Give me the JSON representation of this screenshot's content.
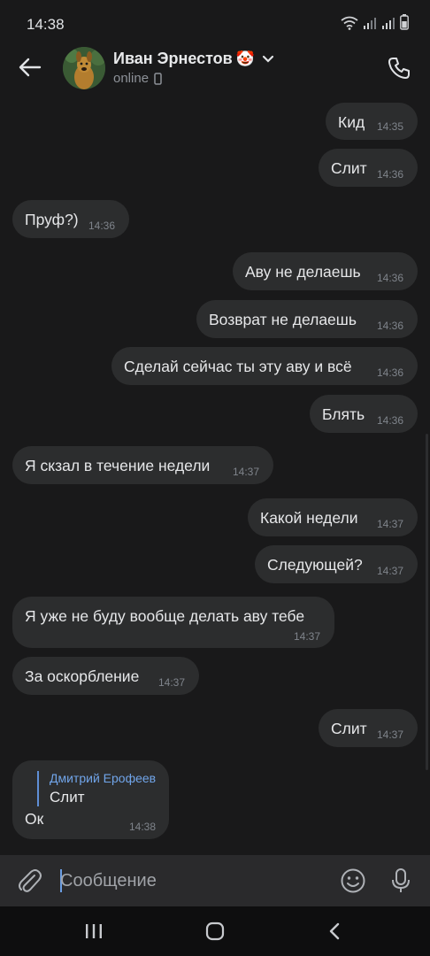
{
  "status_bar": {
    "time": "14:38"
  },
  "header": {
    "name": "Иван Эрнестов",
    "name_emoji": "🤡",
    "status": "online"
  },
  "messages": [
    {
      "dir": "out",
      "text": "Кид",
      "time": "14:35"
    },
    {
      "dir": "out",
      "text": "Слит",
      "time": "14:36"
    },
    {
      "dir": "in",
      "text": "Пруф?)",
      "time": "14:36"
    },
    {
      "dir": "out",
      "text": "Аву не делаешь",
      "time": "14:36"
    },
    {
      "dir": "out",
      "text": "Возврат не делаешь",
      "time": "14:36"
    },
    {
      "dir": "out",
      "text": "Сделай сейчас ты эту аву и всё",
      "time": "14:36"
    },
    {
      "dir": "out",
      "text": "Блять",
      "time": "14:36"
    },
    {
      "dir": "in",
      "text": "Я скзал в течение недели",
      "time": "14:37"
    },
    {
      "dir": "out",
      "text": "Какой недели",
      "time": "14:37"
    },
    {
      "dir": "out",
      "text": "Следующей?",
      "time": "14:37"
    },
    {
      "dir": "in",
      "text": "Я уже не буду вообще делать аву тебе",
      "time": "14:37"
    },
    {
      "dir": "in",
      "text": "За оскорбление",
      "time": "14:37"
    },
    {
      "dir": "out",
      "text": "Слит",
      "time": "14:37"
    }
  ],
  "reply_message": {
    "reply_author": "Дмитрий Ерофеев",
    "reply_text": "Слит",
    "text": "Ок",
    "time": "14:38"
  },
  "composer": {
    "placeholder": "Сообщение"
  },
  "colors": {
    "background": "#19191a",
    "bubble": "#2c2d2e",
    "accent": "#71a5ea"
  }
}
